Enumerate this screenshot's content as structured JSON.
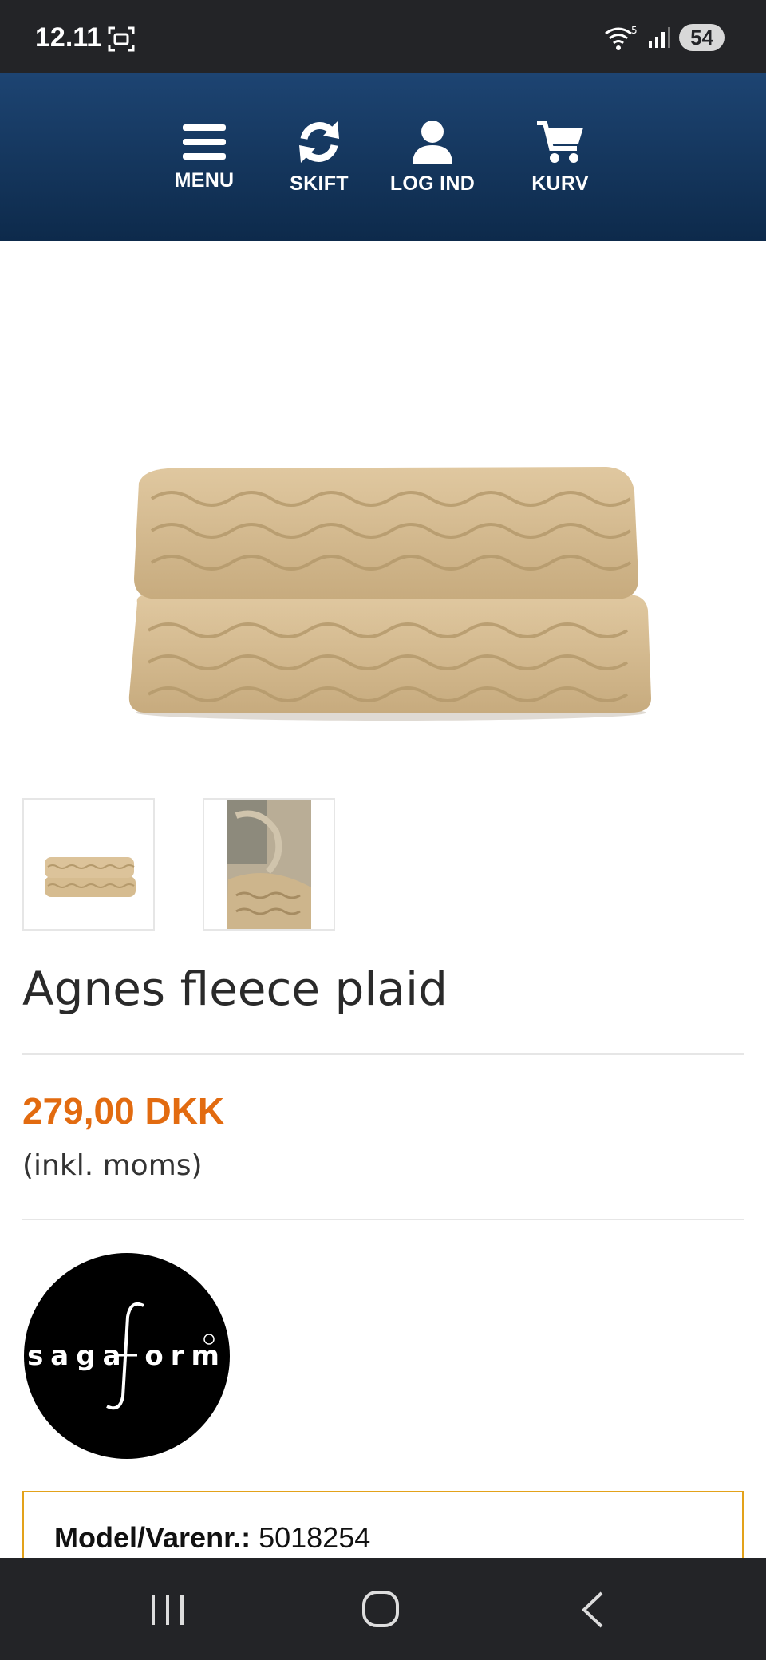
{
  "status_bar": {
    "time": "12.11",
    "battery": "54",
    "icons": [
      "screenshot-icon",
      "wifi-icon",
      "signal-icon",
      "battery-icon"
    ]
  },
  "header": {
    "nav": [
      {
        "label": "MENU",
        "icon": "hamburger-menu-icon"
      },
      {
        "label": "SKIFT",
        "icon": "refresh-icon"
      },
      {
        "label": "LOG IND",
        "icon": "user-icon"
      },
      {
        "label": "KURV",
        "icon": "cart-icon"
      }
    ],
    "colors": {
      "header_top": "#1d4472",
      "header_bottom": "#0d2a4b"
    }
  },
  "product": {
    "image_icon": "folded-blanket-image",
    "thumbnails": [
      "folded-blanket-thumbnail",
      "blanket-on-chair-thumbnail"
    ],
    "title": "Agnes fleece plaid",
    "price": "279,00 DKK",
    "price_note": "(inkl. moms)",
    "price_color": "#e26b10",
    "brand_logo_text": "sagaform",
    "model_label": "Model/Varenr.:",
    "model_value": "5018254",
    "info_border_color": "#e3a21a"
  },
  "system_nav": {
    "icons": [
      "recent-apps-icon",
      "home-icon",
      "back-icon"
    ]
  }
}
